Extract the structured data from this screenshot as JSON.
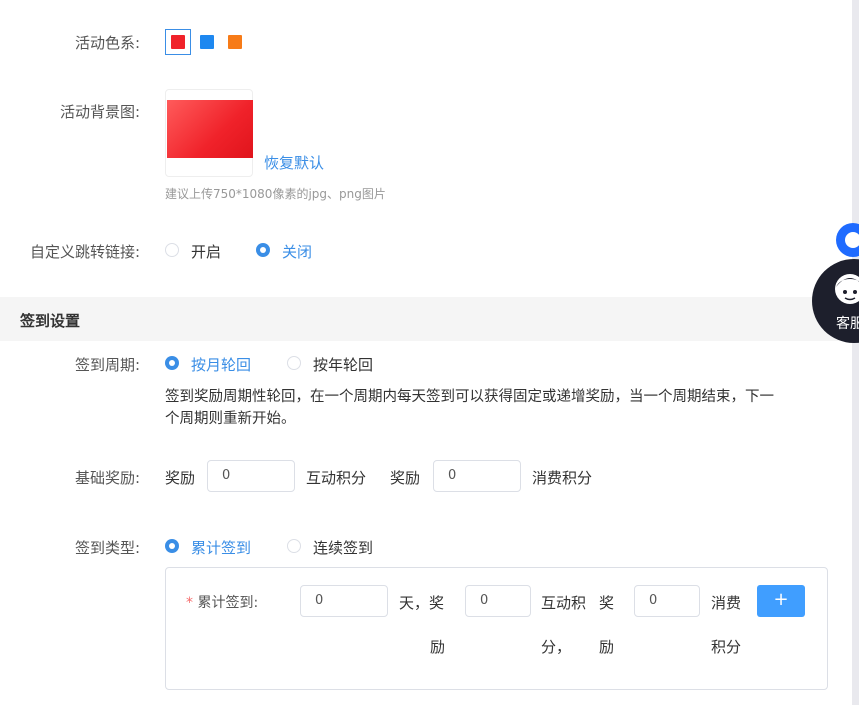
{
  "activity": {
    "color_label": "活动色系:",
    "colors": [
      "#f0222a",
      "#1e88f0",
      "#f77b18"
    ],
    "bg_label": "活动背景图:",
    "restore_default": "恢复默认",
    "upload_hint": "建议上传750*1080像素的jpg、png图片",
    "jump_label": "自定义跳转链接:",
    "jump_on": "开启",
    "jump_off": "关闭"
  },
  "signin": {
    "section_title": "签到设置",
    "cycle_label": "签到周期:",
    "cycle_monthly": "按月轮回",
    "cycle_yearly": "按年轮回",
    "cycle_desc_line1": "签到奖励周期性轮回，在一个周期内每天签到可以获得固定或递增奖励，当一个周期结束，下一",
    "cycle_desc_line2": "个周期则重新开始。",
    "base_label": "基础奖励:",
    "reward_word": "奖励",
    "base_points1": "0",
    "unit_interact": "互动积分",
    "base_points2": "0",
    "unit_consume": "消费积分",
    "type_label": "签到类型:",
    "type_cumulative": "累计签到",
    "type_continuous": "连续签到",
    "rule": {
      "required_mark": "*",
      "label": "累计签到:",
      "days_value": "0",
      "days_suffix_a": "天，奖",
      "days_suffix_b": "励",
      "interact_value": "0",
      "interact_a": "互动积",
      "interact_b": "分，",
      "reward_a": "奖",
      "reward_b": "励",
      "consume_value": "0",
      "consume_a": "消费",
      "consume_b": "积分",
      "add_label": "+"
    }
  },
  "float": {
    "cs_label": "客服"
  }
}
